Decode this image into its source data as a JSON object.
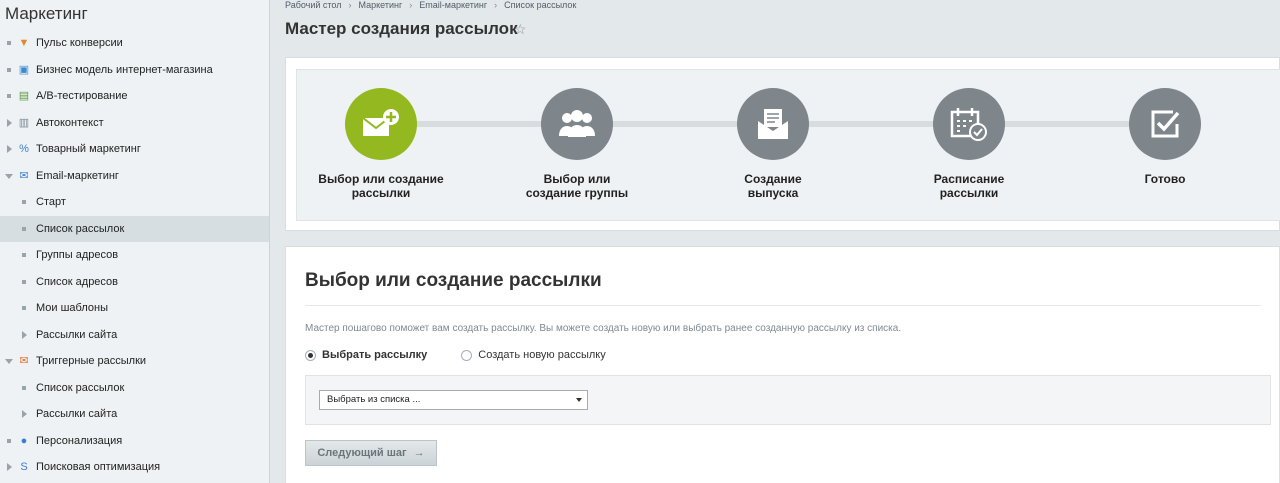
{
  "sidebar": {
    "title": "Маркетинг",
    "items": [
      {
        "label": "Пульс конверсии",
        "marker": "bullet",
        "icon": "funnel-icon",
        "active": false,
        "sub": false
      },
      {
        "label": "Бизнес модель интернет-магазина",
        "marker": "bullet",
        "icon": "shop-model-icon",
        "active": false,
        "sub": false
      },
      {
        "label": "A/B-тестирование",
        "marker": "bullet",
        "icon": "ab-test-icon",
        "active": false,
        "sub": false
      },
      {
        "label": "Автоконтекст",
        "marker": "arrow",
        "icon": "chart-icon",
        "active": false,
        "sub": false
      },
      {
        "label": "Товарный маркетинг",
        "marker": "arrow",
        "icon": "percent-icon",
        "active": false,
        "sub": false
      },
      {
        "label": "Email-маркетинг",
        "marker": "arrow-down",
        "icon": "email-icon",
        "active": false,
        "sub": false
      },
      {
        "label": "Старт",
        "marker": "bullet",
        "icon": "",
        "active": false,
        "sub": true
      },
      {
        "label": "Список рассылок",
        "marker": "bullet",
        "icon": "",
        "active": true,
        "sub": true
      },
      {
        "label": "Группы адресов",
        "marker": "bullet",
        "icon": "",
        "active": false,
        "sub": true
      },
      {
        "label": "Список адресов",
        "marker": "bullet",
        "icon": "",
        "active": false,
        "sub": true
      },
      {
        "label": "Мои шаблоны",
        "marker": "bullet",
        "icon": "",
        "active": false,
        "sub": true
      },
      {
        "label": "Рассылки сайта",
        "marker": "arrow",
        "icon": "",
        "active": false,
        "sub": true
      },
      {
        "label": "Триггерные рассылки",
        "marker": "arrow-down",
        "icon": "trigger-mail-icon",
        "active": false,
        "sub": false
      },
      {
        "label": "Список рассылок",
        "marker": "bullet",
        "icon": "",
        "active": false,
        "sub": true
      },
      {
        "label": "Рассылки сайта",
        "marker": "arrow",
        "icon": "",
        "active": false,
        "sub": true
      },
      {
        "label": "Персонализация",
        "marker": "bullet",
        "icon": "personalization-icon",
        "active": false,
        "sub": false
      },
      {
        "label": "Поисковая оптимизация",
        "marker": "arrow",
        "icon": "seo-icon",
        "active": false,
        "sub": false
      }
    ]
  },
  "breadcrumb": [
    "Рабочий стол",
    "Маркетинг",
    "Email-маркетинг",
    "Список рассылок"
  ],
  "page_title": "Мастер создания рассылок",
  "steps": [
    {
      "label": "Выбор или создание\nрассылки",
      "icon": "mail-add-icon",
      "active": true
    },
    {
      "label": "Выбор или\nсоздание группы",
      "icon": "group-icon",
      "active": false
    },
    {
      "label": "Создание\nвыпуска",
      "icon": "open-envelope-icon",
      "active": false
    },
    {
      "label": "Расписание\nрассылки",
      "icon": "calendar-check-icon",
      "active": false
    },
    {
      "label": "Готово",
      "icon": "checkbox-icon",
      "active": false
    }
  ],
  "form": {
    "title": "Выбор или создание рассылки",
    "description": "Мастер пошагово поможет вам создать рассылку. Вы можете создать новую или выбрать ранее созданную рассылку из списка.",
    "radio_select_label": "Выбрать рассылку",
    "radio_create_label": "Создать новую рассылку",
    "select_value": "Выбрать из списка ...",
    "next_button": "Следующий шаг",
    "next_arrow": "→"
  },
  "star_glyph": "☆",
  "colors": {
    "active_step": "#94b820",
    "inactive_step": "#7e868c"
  }
}
